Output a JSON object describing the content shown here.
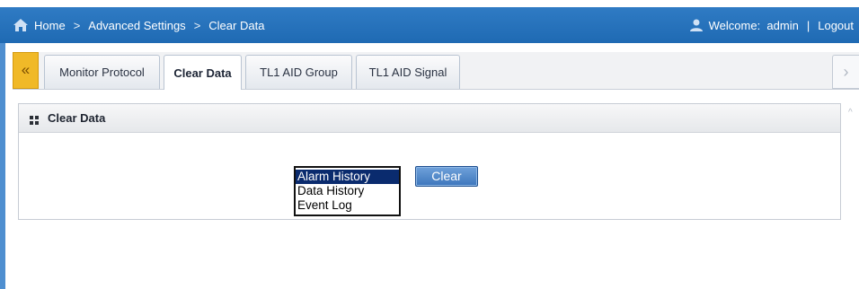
{
  "header": {
    "breadcrumb": [
      "Home",
      "Advanced Settings",
      "Clear Data"
    ],
    "separator": ">",
    "welcome_label": "Welcome:",
    "username": "admin",
    "divider": "|",
    "logout_label": "Logout"
  },
  "tabs": {
    "prev_glyph": "«",
    "next_glyph": "›",
    "items": [
      {
        "label": "Monitor Protocol",
        "active": false
      },
      {
        "label": "Clear Data",
        "active": true
      },
      {
        "label": "TL1 AID Group",
        "active": false
      },
      {
        "label": "TL1 AID Signal",
        "active": false
      }
    ]
  },
  "panel": {
    "title": "Clear Data",
    "options": [
      "Alarm History",
      "Data History",
      "Event Log"
    ],
    "selected_option": "Alarm History",
    "clear_label": "Clear"
  },
  "colors": {
    "topbar": "#2a76c0",
    "tab_prev": "#f0b928",
    "selected_option": "#0a2b6e",
    "button": "#4f86c8"
  },
  "icons": {
    "home": "home-icon",
    "user": "user-icon",
    "panel": "grid-icon"
  }
}
